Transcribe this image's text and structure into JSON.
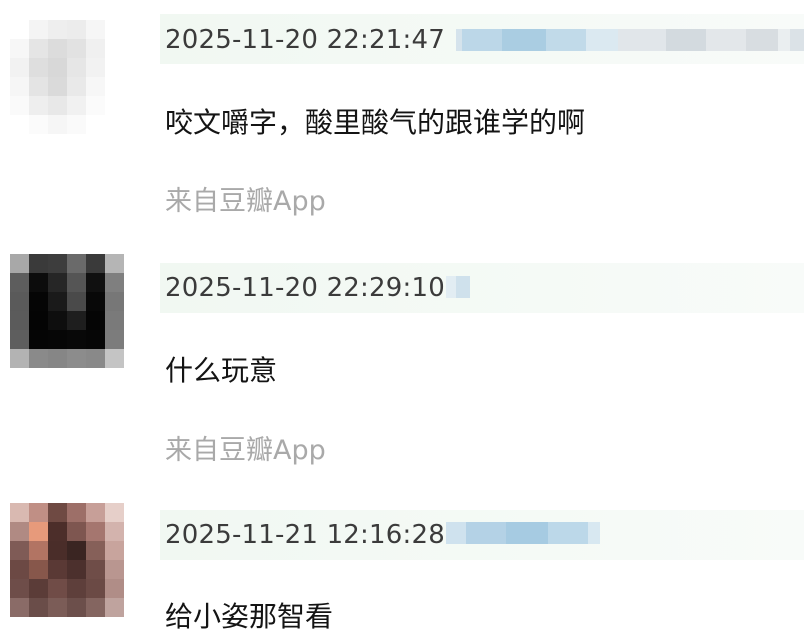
{
  "comments": [
    {
      "timestamp": "2025-11-20 22:21:47",
      "text": "咬文嚼字，酸里酸气的跟谁学的啊",
      "source": "来自豆瓣App"
    },
    {
      "timestamp": "2025-11-20 22:29:10",
      "text": "什么玩意",
      "source": "来自豆瓣App"
    },
    {
      "timestamp": "2025-11-21 12:16:28",
      "text": "给小姿那智看",
      "source": ""
    }
  ],
  "colors": {
    "meta_bar": "#f1f8f2",
    "source_text": "#a9a9a9",
    "blurred_name": "#b9d5e6"
  }
}
